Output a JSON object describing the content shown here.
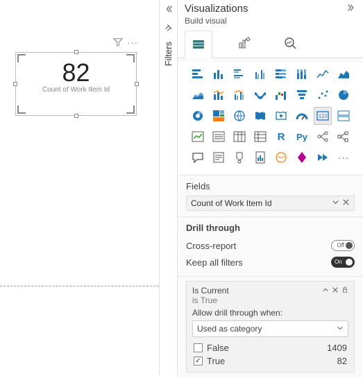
{
  "canvas": {
    "visual": {
      "value": "82",
      "label": "Count of Work Item Id"
    }
  },
  "filters_tab": {
    "label": "Filters"
  },
  "pane": {
    "title": "Visualizations",
    "subtitle": "Build visual",
    "fields_section": "Fields",
    "field_well": "Count of Work Item Id",
    "drill": {
      "title": "Drill through",
      "cross_report": "Cross-report",
      "keep_filters": "Keep all filters",
      "cross_report_toggle": "Off",
      "keep_filters_toggle": "On"
    },
    "filter_card": {
      "name": "Is Current",
      "subtitle": "is True",
      "allow_label": "Allow drill through when:",
      "select_value": "Used as category",
      "options": [
        {
          "label": "False",
          "count": "1409",
          "checked": false
        },
        {
          "label": "True",
          "count": "82",
          "checked": true
        }
      ]
    }
  },
  "chart_data": {
    "type": "table",
    "title": "Is Current",
    "categories": [
      "False",
      "True"
    ],
    "values": [
      1409,
      82
    ]
  }
}
